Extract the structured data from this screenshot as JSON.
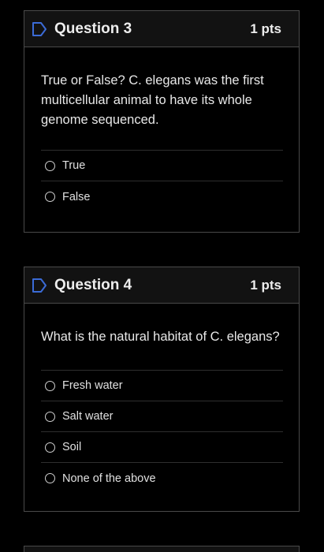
{
  "questions": [
    {
      "title": "Question 3",
      "points": "1 pts",
      "text": "True or False? C. elegans was the first multicellular animal to have its whole genome sequenced.",
      "answers": [
        "True",
        "False"
      ]
    },
    {
      "title": "Question 4",
      "points": "1 pts",
      "text": "What is the natural habitat of C. elegans?",
      "answers": [
        "Fresh water",
        "Salt water",
        "Soil",
        "None of the above"
      ]
    }
  ],
  "icons": {
    "flag": "flag-bookmark-icon"
  },
  "colors": {
    "background": "#000000",
    "header_bg": "#121212",
    "border": "#4a4a4a",
    "accent_flag": "#3b6bd6"
  }
}
